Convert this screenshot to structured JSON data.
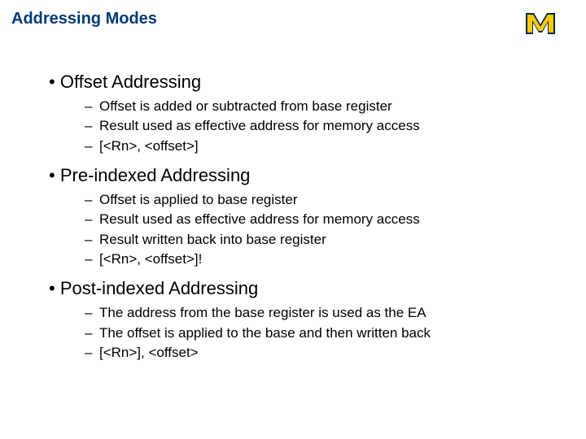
{
  "title": "Addressing Modes",
  "logo": {
    "letter": "M",
    "maize": "#ffcb05",
    "blue": "#00274c"
  },
  "sections": [
    {
      "heading": "Offset Addressing",
      "items": [
        "Offset is added or subtracted from base register",
        "Result used as effective address for memory access",
        "[<Rn>, <offset>]"
      ]
    },
    {
      "heading": "Pre-indexed Addressing",
      "items": [
        "Offset is applied to base register",
        "Result used as effective address for memory access",
        "Result written back into base register",
        "[<Rn>, <offset>]!"
      ]
    },
    {
      "heading": "Post-indexed Addressing",
      "items": [
        "The address from the base register is used as the EA",
        "The offset is applied to the base and then written back",
        "[<Rn>], <offset>"
      ]
    }
  ]
}
